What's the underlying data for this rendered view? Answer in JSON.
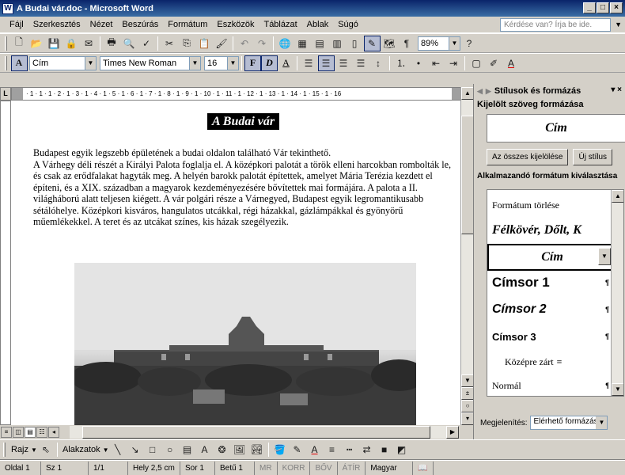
{
  "window": {
    "title": "A Budai vár.doc - Microsoft Word",
    "min": "_",
    "max": "□",
    "close": "×"
  },
  "menu": {
    "items": [
      "Fájl",
      "Szerkesztés",
      "Nézet",
      "Beszúrás",
      "Formátum",
      "Eszközök",
      "Táblázat",
      "Ablak",
      "Súgó"
    ],
    "help_placeholder": "Kérdése van? Írja be ide."
  },
  "toolbar_standard": {
    "zoom": "89%"
  },
  "toolbar_format": {
    "style": "Cím",
    "font": "Times New Roman",
    "size": "16",
    "bold": "F",
    "italic": "D",
    "underline": "A"
  },
  "ruler": {
    "h_labels": "· 1 · 1 · 1 · 2 · 1 · 3 · 1 · 4 · 1 · 5 · 1 · 6 · 1 · 7 · 1 · 8 · 1 · 9 · 1 · 10 · 1 · 11 · 1 · 12 · 1 · 13 · 1 · 14 · 1 · 15 · 1 · 16"
  },
  "document": {
    "title": "A Budai vár",
    "paragraphs": [
      "Budapest egyik legszebb épületének a budai oldalon található Vár tekinthető.",
      "A Várhegy déli részét a Királyi Palota foglalja el. A középkori palotát a török elleni harcokban rombolták le, és csak az erődfalakat hagyták meg. A helyén barokk palotát építettek, amelyet Mária Terézia kezdett el építeni, és a XIX. században a magyarok kezdeményezésére bővítettek mai formájára. A palota a II. világháború alatt teljesen kiégett. A vár polgári része a Várnegyed, Budapest egyik legromantikusabb sétálóhelye. Középkori kisváros, hangulatos utcákkal, régi házakkal, gázlámpákkal és gyönyörű műemlékekkel. A teret és az utcákat színes, kis házak szegélyezik."
    ]
  },
  "taskpane": {
    "title": "Stílusok és formázás",
    "selected_label": "Kijelölt szöveg formázása",
    "selected_value": "Cím",
    "select_all": "Az összes kijelölése",
    "new_style": "Új stílus",
    "apply_label": "Alkalmazandó formátum kiválasztása",
    "styles": [
      "Formátum törlése",
      "Félkövér, Dőlt, K",
      "Cím",
      "Címsor 1",
      "Címsor 2",
      "Címsor 3",
      "Középre zárt",
      "Normál"
    ],
    "show_label": "Megjelenítés:",
    "show_value": "Elérhető formázás"
  },
  "drawing": {
    "draw": "Rajz",
    "autoshapes": "Alakzatok"
  },
  "status": [
    "Oldal 1",
    "Sz 1",
    "1/1",
    "Hely 2,5 cm",
    "Sor 1",
    "Betű 1",
    "MR",
    "KORR",
    "BŐV",
    "ÁTÍR",
    "Magyar"
  ]
}
